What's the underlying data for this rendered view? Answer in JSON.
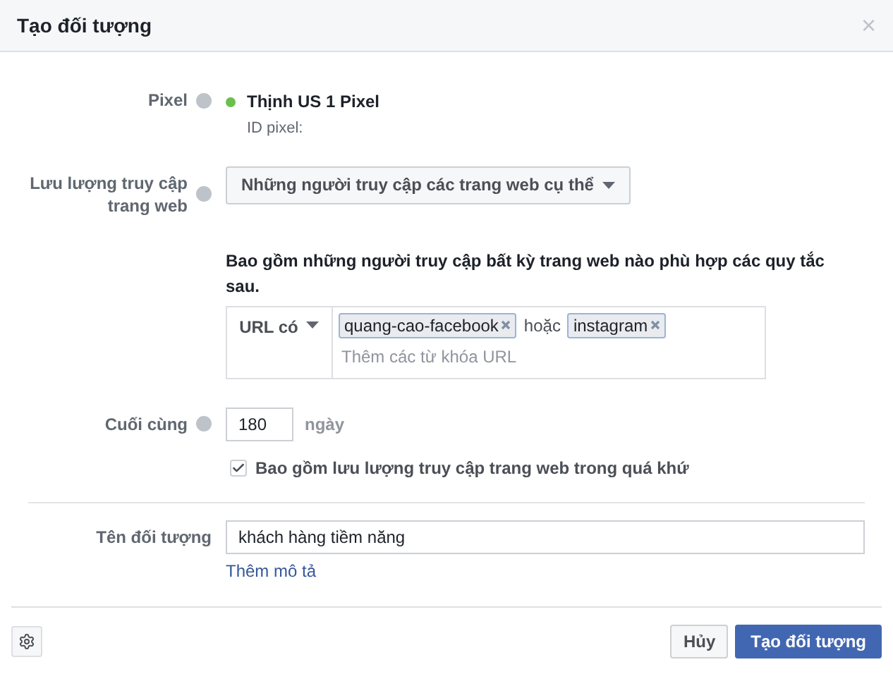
{
  "dialog": {
    "title": "Tạo đối tượng",
    "close": "×"
  },
  "pixel": {
    "label": "Pixel",
    "active": true,
    "name": "Thịnh US 1 Pixel",
    "id_label": "ID pixel:"
  },
  "traffic": {
    "label": "Lưu lượng truy cập trang web",
    "dropdown": "Những người truy cập các trang web cụ thể"
  },
  "rule": {
    "description": "Bao gồm những người truy cập bất kỳ trang web nào phù hợp các quy tắc sau.",
    "operator": "URL có",
    "tags": [
      {
        "text": "quang-cao-facebook"
      },
      {
        "text": "instagram"
      }
    ],
    "joiner": "hoặc",
    "placeholder": "Thêm các từ khóa URL"
  },
  "duration": {
    "label": "Cuối cùng",
    "value": "180",
    "unit": "ngày"
  },
  "past_traffic": {
    "label": "Bao gồm lưu lượng truy cập trang web trong quá khứ",
    "checked": true
  },
  "audience_name": {
    "label": "Tên đối tượng",
    "value": "khách hàng tiềm năng",
    "link": "Thêm mô tả"
  },
  "buttons": [
    {
      "label": "Hủy",
      "kind": "secondary"
    },
    {
      "label": "Tạo đối tượng",
      "kind": "primary"
    }
  ]
}
